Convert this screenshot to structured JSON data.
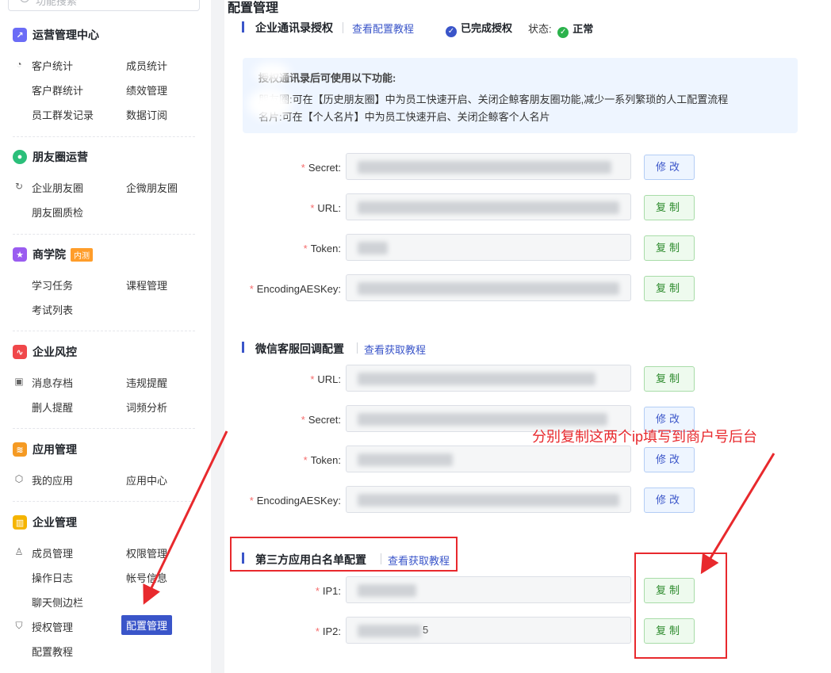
{
  "sidebar": {
    "search_placeholder": "功能搜索",
    "sections": [
      {
        "title": "运营管理中心",
        "icon": "chart-icon",
        "color": "#6b6cf6",
        "items": [
          [
            "客户统计",
            "成员统计"
          ],
          [
            "客户群统计",
            "绩效管理"
          ],
          [
            "员工群发记录",
            "数据订阅"
          ]
        ]
      },
      {
        "title": "朋友圈运营",
        "icon": "moments-icon",
        "color": "#2bbf7a",
        "items": [
          [
            "企业朋友圈",
            "企微朋友圈"
          ],
          [
            "朋友圈质检",
            ""
          ]
        ]
      },
      {
        "title": "商学院",
        "badge": "内测",
        "icon": "star-icon",
        "color": "#9a5cf0",
        "items": [
          [
            "学习任务",
            "课程管理"
          ],
          [
            "考试列表",
            ""
          ]
        ]
      },
      {
        "title": "企业风控",
        "icon": "pulse-icon",
        "color": "#f0474a",
        "items": [
          [
            "消息存档",
            "违规提醒"
          ],
          [
            "删人提醒",
            "词频分析"
          ]
        ]
      },
      {
        "title": "应用管理",
        "icon": "layers-icon",
        "color": "#f59a23",
        "items": [
          [
            "我的应用",
            "应用中心"
          ]
        ]
      },
      {
        "title": "企业管理",
        "icon": "building-icon",
        "color": "#f5b400",
        "items": [
          [
            "成员管理",
            "权限管理"
          ],
          [
            "操作日志",
            "帐号信息"
          ],
          [
            "聊天侧边栏",
            ""
          ],
          [
            "授权管理",
            "配置管理"
          ],
          [
            "配置教程",
            ""
          ]
        ]
      }
    ]
  },
  "main": {
    "page_title": "配置管理",
    "contacts": {
      "title": "企业通讯录授权",
      "link": "查看配置教程",
      "auth_status": "已完成授权",
      "state_label": "状态:",
      "state_value": "正常",
      "info_title": "授权通讯录后可使用以下功能:",
      "info_line1": "朋友圈:可在【历史朋友圈】中为员工快速开启、关闭企鲸客朋友圈功能,减少一系列繁琐的人工配置流程",
      "info_line2": "名片:可在【个人名片】中为员工快速开启、关闭企鲸客个人名片",
      "fields": [
        {
          "label": "Secret:",
          "button": "修改"
        },
        {
          "label": "URL:",
          "button": "复制"
        },
        {
          "label": "Token:",
          "button": "复制"
        },
        {
          "label": "EncodingAESKey:",
          "button": "复制"
        }
      ]
    },
    "wechat_cs": {
      "title": "微信客服回调配置",
      "link": "查看获取教程",
      "fields": [
        {
          "label": "URL:",
          "button": "复制"
        },
        {
          "label": "Secret:",
          "button": "修改"
        },
        {
          "label": "Token:",
          "button": "修改"
        },
        {
          "label": "EncodingAESKey:",
          "button": "修改"
        }
      ]
    },
    "whitelist": {
      "title": "第三方应用白名单配置",
      "link": "查看获取教程",
      "fields": [
        {
          "label": "IP1:",
          "button": "复制",
          "value": ""
        },
        {
          "label": "IP2:",
          "button": "复制",
          "value": "5"
        }
      ]
    }
  },
  "annotation": {
    "text": "分别复制这两个ip填写到商户号后台",
    "color": "#e8292d"
  }
}
